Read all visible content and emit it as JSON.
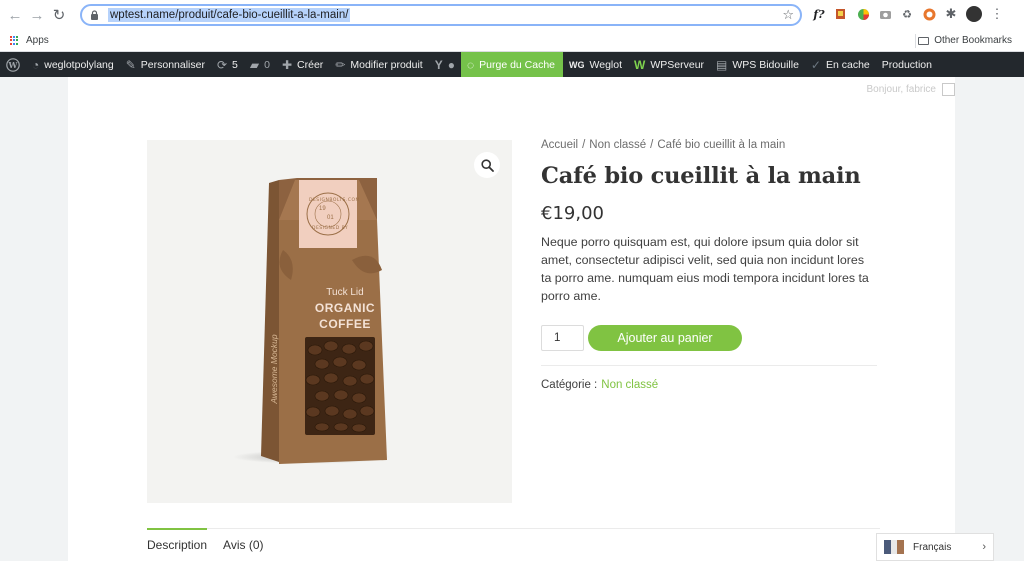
{
  "browser": {
    "url": "wptest.name/produit/cafe-bio-cueillit-a-la-main/",
    "bookmarks": {
      "apps_label": "Apps",
      "other_label": "Other Bookmarks"
    },
    "extensions": [
      "f?",
      "P",
      "◕",
      "◎",
      "♻",
      "●",
      "puzzle"
    ]
  },
  "admin_bar": {
    "site_name": "weglotpolylang",
    "customize": "Personnaliser",
    "updates_count": "5",
    "comments_count": "0",
    "create": "Créer",
    "edit_product": "Modifier produit",
    "purge_cache": "Purge du Cache",
    "weglot": "Weglot",
    "wpserveur": "WPServeur",
    "wps_bidouille": "WPS Bidouille",
    "en_cache": "En cache",
    "production": "Production"
  },
  "page": {
    "greeting": "Bonjour, fabrice"
  },
  "product": {
    "breadcrumb": [
      "Accueil",
      "Non classé",
      "Café bio cueillit à la main"
    ],
    "breadcrumb_sep": "/",
    "title": "Café bio cueillit à la main",
    "price": "€19,00",
    "description": "Neque porro quisquam est, qui dolore ipsum quia dolor sit amet, consectetur adipisci velit, sed quia non incidunt lores ta porro ame. numquam eius modi tempora incidunt lores ta porro ame.",
    "quantity": "1",
    "add_to_cart": "Ajouter au panier",
    "category_label": "Catégorie :",
    "category_value": "Non classé",
    "image": {
      "label_top": "Tuck Lid",
      "label_main_1": "ORGANIC",
      "label_main_2": "COFFEE",
      "side_text": "Awesome Mockup",
      "badge_line1": "DESIGNBOLTS.COM",
      "badge_line2": "DESIGNED BY",
      "badge_num_1": "19",
      "badge_num_2": "01"
    }
  },
  "tabs": [
    "Description",
    "Avis (0)"
  ],
  "language_switcher": {
    "label": "Français"
  },
  "colors": {
    "accent": "#80c342",
    "admin_bar": "#23282d",
    "purge": "#75c24a",
    "bag": "#9b6f47",
    "bag_label": "#f1cfbf"
  }
}
